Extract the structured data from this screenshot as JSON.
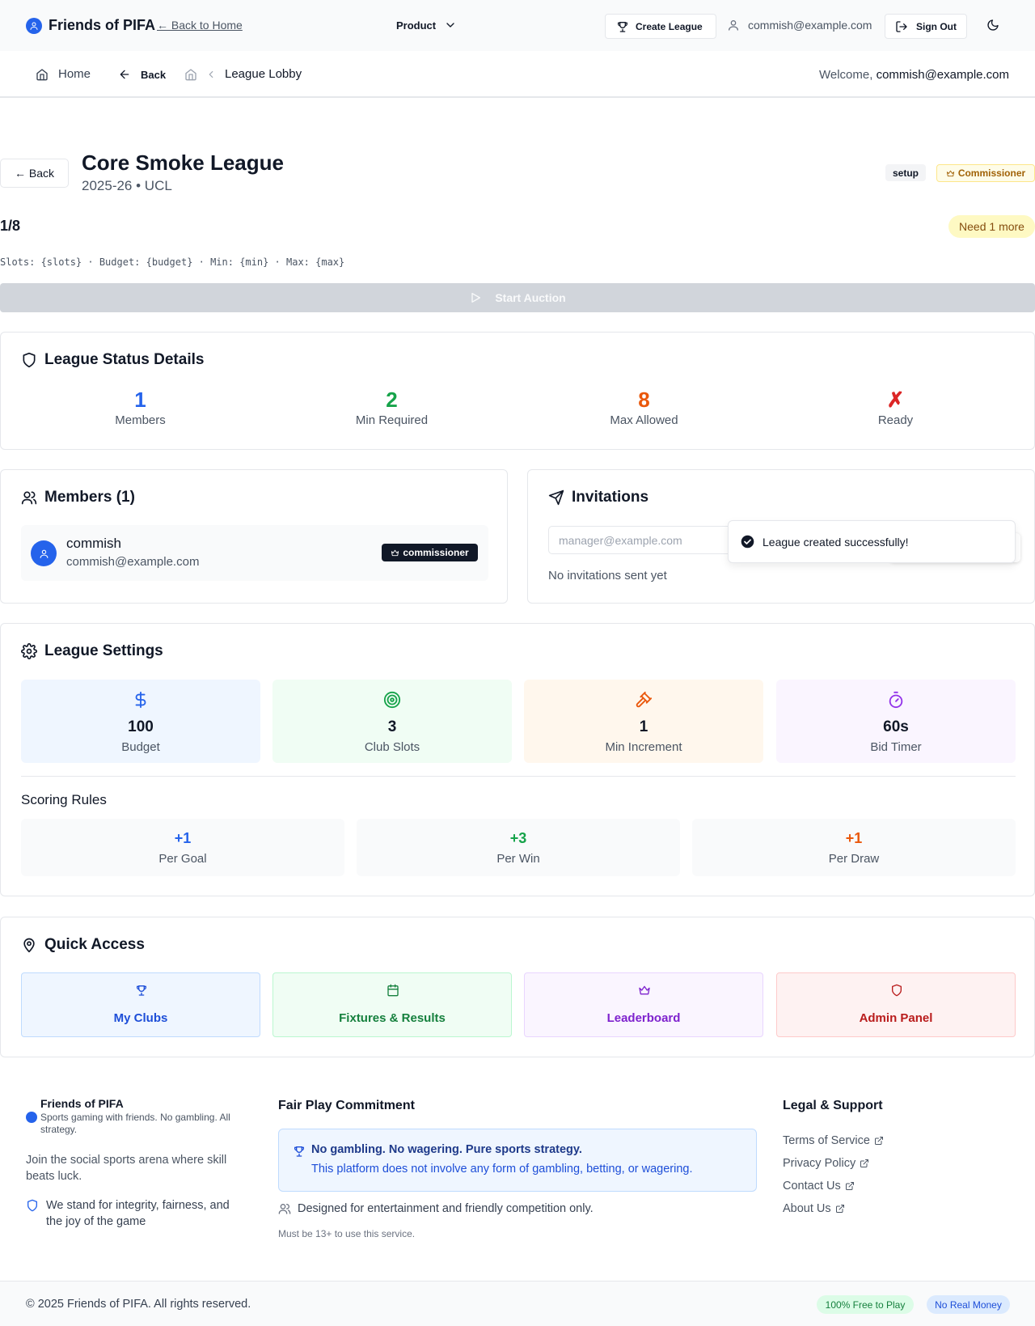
{
  "nav": {
    "brand": "Friends of PIFA",
    "back_home": "← Back to Home",
    "product": "Product",
    "create_league": "Create League",
    "user_email": "commish@example.com",
    "sign_out": "Sign Out"
  },
  "subnav": {
    "home": "Home",
    "back": "Back",
    "crumb": "League Lobby",
    "welcome_prefix": "Welcome, ",
    "welcome_user": "commish@example.com"
  },
  "header": {
    "back_button": "← Back",
    "title": "Core Smoke League",
    "subtitle": "2025-26 • UCL",
    "status_badge": "setup",
    "role_badge": "Commissioner",
    "member_count": "1/8",
    "need_more": "Need 1 more",
    "template_line": "Slots: {slots} · Budget: {budget} · Min: {min} · Max: {max}",
    "start_auction": "Start Auction"
  },
  "status": {
    "title": "League Status Details",
    "stats": [
      {
        "value": "1",
        "label": "Members",
        "color": "#2563eb"
      },
      {
        "value": "2",
        "label": "Min Required",
        "color": "#16a34a"
      },
      {
        "value": "8",
        "label": "Max Allowed",
        "color": "#ea580c"
      },
      {
        "value": "✗",
        "label": "Ready",
        "color": "#dc2626"
      }
    ]
  },
  "members": {
    "title": "Members (1)",
    "items": [
      {
        "name": "commish",
        "email": "commish@example.com",
        "role": "commissioner"
      }
    ]
  },
  "invitations": {
    "title": "Invitations",
    "placeholder": "manager@example.com",
    "empty": "No invitations sent yet"
  },
  "toast": {
    "message": "League created successfully!"
  },
  "settings": {
    "title": "League Settings",
    "tiles": [
      {
        "value": "100",
        "label": "Budget",
        "icon": "dollar-icon",
        "bg": "#eff6ff",
        "color": "#2563eb"
      },
      {
        "value": "3",
        "label": "Club Slots",
        "icon": "target-icon",
        "bg": "#f0fdf4",
        "color": "#16a34a"
      },
      {
        "value": "1",
        "label": "Min Increment",
        "icon": "gavel-icon",
        "bg": "#fff7ed",
        "color": "#ea580c"
      },
      {
        "value": "60s",
        "label": "Bid Timer",
        "icon": "timer-icon",
        "bg": "#faf5ff",
        "color": "#9333ea"
      }
    ],
    "scoring_title": "Scoring Rules",
    "scoring": [
      {
        "value": "+1",
        "label": "Per Goal",
        "color": "#2563eb"
      },
      {
        "value": "+3",
        "label": "Per Win",
        "color": "#16a34a"
      },
      {
        "value": "+1",
        "label": "Per Draw",
        "color": "#ea580c"
      }
    ]
  },
  "quick_access": {
    "title": "Quick Access",
    "tiles": [
      {
        "label": "My Clubs",
        "icon": "trophy-icon",
        "bg": "#eff6ff",
        "border": "#bfdbfe",
        "color": "#1d4ed8"
      },
      {
        "label": "Fixtures & Results",
        "icon": "calendar-icon",
        "bg": "#f0fdf4",
        "border": "#bbf7d0",
        "color": "#15803d"
      },
      {
        "label": "Leaderboard",
        "icon": "crown-icon",
        "bg": "#faf5ff",
        "border": "#e9d5ff",
        "color": "#7e22ce"
      },
      {
        "label": "Admin Panel",
        "icon": "shield-icon",
        "bg": "#fef2f2",
        "border": "#fecaca",
        "color": "#b91c1c"
      }
    ]
  },
  "footer": {
    "brand": "Friends of PIFA",
    "tagline": "Sports gaming with friends. No gambling. All strategy.",
    "join": "Join the social sports arena where skill beats luck.",
    "integrity": "We stand for integrity, fairness, and the joy of the game",
    "fair_title": "Fair Play Commitment",
    "fair_heading": "No gambling. No wagering. Pure sports strategy.",
    "fair_text": "This platform does not involve any form of gambling, betting, or wagering.",
    "designed": "Designed for entertainment and friendly competition only.",
    "age": "Must be 13+ to use this service.",
    "legal_title": "Legal & Support",
    "links": [
      "Terms of Service",
      "Privacy Policy",
      "Contact Us",
      "About Us"
    ],
    "copyright": "© 2025 Friends of PIFA. All rights reserved.",
    "badge_free": "100% Free to Play",
    "badge_money": "No Real Money"
  }
}
